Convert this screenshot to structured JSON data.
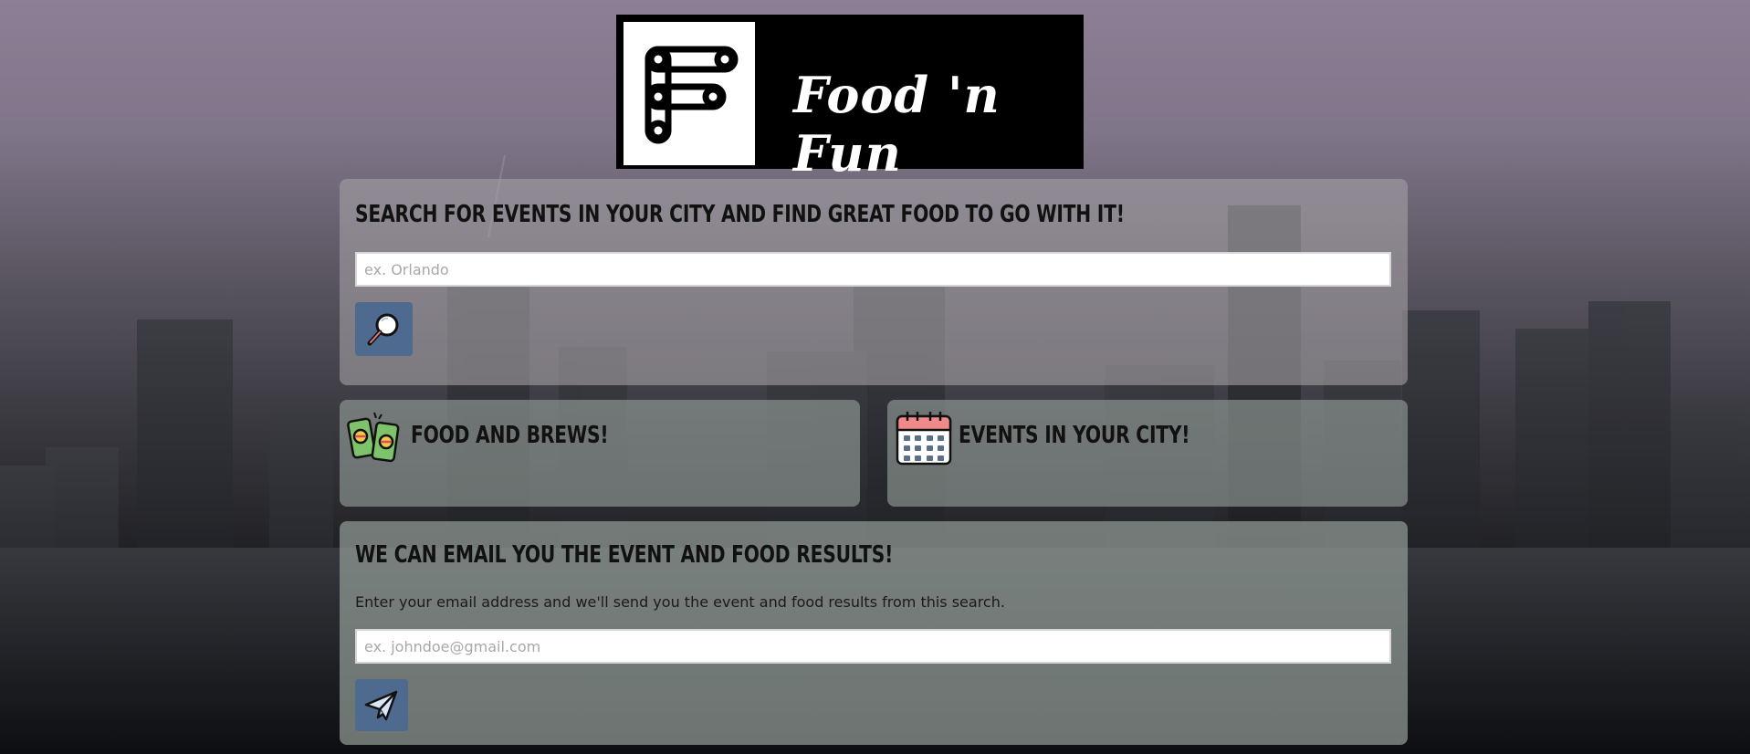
{
  "logo": {
    "text": "Food 'n Fun",
    "icon": "letter-f-logo-icon"
  },
  "search": {
    "heading": "Search for events in your city and find great food to go with it!",
    "placeholder": "ex. Orlando",
    "value": "",
    "button_icon": "magnifier-icon"
  },
  "food": {
    "heading": "Food and Brews!",
    "icon": "beer-cans-icon"
  },
  "events": {
    "heading": "Events in your city!",
    "icon": "calendar-icon"
  },
  "email": {
    "heading": "We can email you the event and food results!",
    "description": "Enter your email address and we'll send you the event and food results from this search.",
    "placeholder": "ex. johndoe@gmail.com",
    "value": "",
    "button_icon": "paper-plane-icon"
  },
  "colors": {
    "button": "#4e6a8e",
    "logo_bg": "#000000"
  }
}
